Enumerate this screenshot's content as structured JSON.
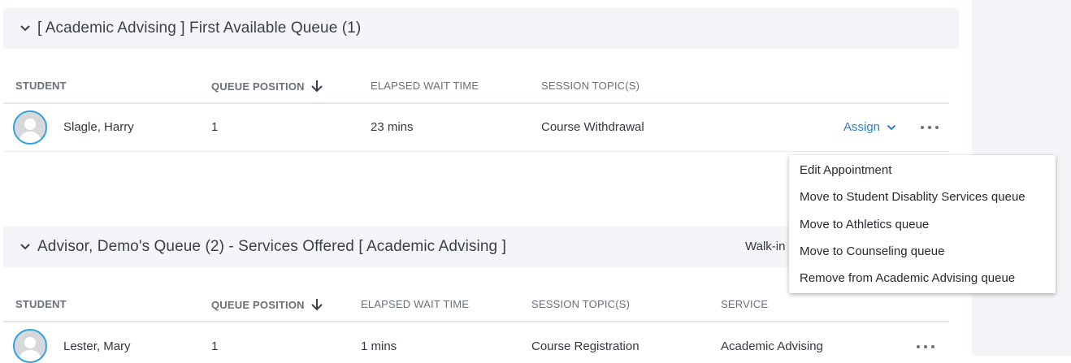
{
  "queue1": {
    "title": "[ Academic Advising ] First Available Queue (1)",
    "columns": {
      "student": "STUDENT",
      "queue_position": "QUEUE POSITION",
      "elapsed_wait_time": "ELAPSED WAIT TIME",
      "session_topics": "SESSION TOPIC(S)"
    },
    "rows": [
      {
        "student": "Slagle, Harry",
        "queue_position": "1",
        "elapsed_wait_time": "23 mins",
        "session_topics": "Course Withdrawal",
        "assign_label": "Assign"
      }
    ]
  },
  "queue2": {
    "title": "Advisor, Demo's Queue (2) - Services Offered [ Academic Advising ]",
    "walk_in_label": "Walk-in",
    "columns": {
      "student": "STUDENT",
      "queue_position": "QUEUE POSITION",
      "elapsed_wait_time": "ELAPSED WAIT TIME",
      "session_topics": "SESSION TOPIC(S)",
      "service": "SERVICE"
    },
    "rows": [
      {
        "student": "Lester, Mary",
        "queue_position": "1",
        "elapsed_wait_time": "1 mins",
        "session_topics": "Course Registration",
        "service": "Academic Advising"
      }
    ]
  },
  "context_menu": {
    "items": [
      "Edit Appointment",
      "Move to Student Disablity Services queue",
      "Move to Athletics queue",
      "Move to Counseling queue",
      "Remove from Academic Advising queue"
    ]
  },
  "colors": {
    "accent": "#2e7fd0",
    "avatar_ring": "#2ea2df",
    "header_bg": "#f3f5f8"
  },
  "icons": {
    "expand": "chevron-down-icon",
    "sort": "arrow-down-icon",
    "more": "more-horizontal-icon",
    "avatar": "user-silhouette-icon"
  }
}
